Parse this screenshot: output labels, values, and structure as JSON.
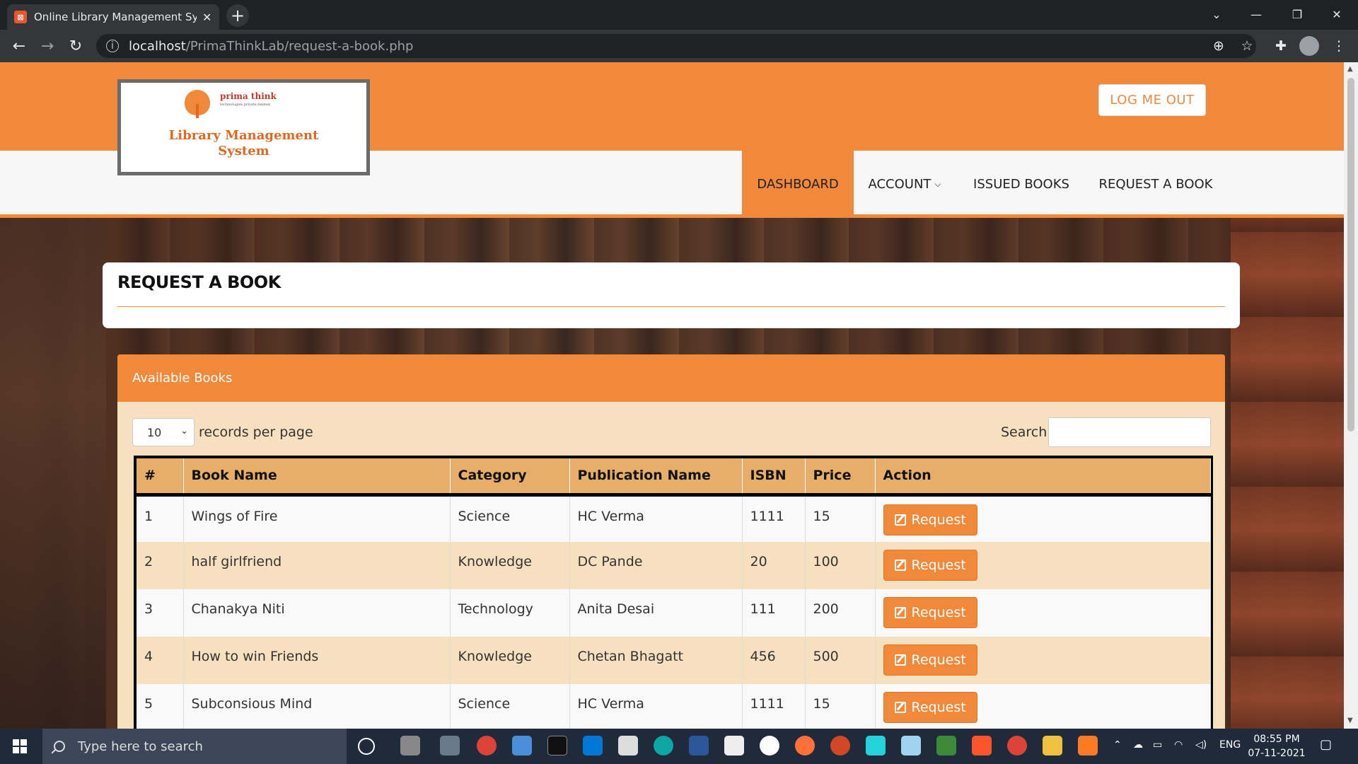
{
  "browser": {
    "tab_title": "Online Library Management System",
    "url_host": "localhost",
    "url_path": "/PrimaThinkLab/request-a-book.php"
  },
  "site": {
    "brand": "prima think",
    "brand_sub": "technologies private limited",
    "system_title": "Library Management System",
    "logout_label": "LOG ME OUT",
    "menu": [
      {
        "label": "DASHBOARD",
        "active": true
      },
      {
        "label": "ACCOUNT",
        "active": false
      },
      {
        "label": "ISSUED BOOKS",
        "active": false
      },
      {
        "label": "REQUEST A BOOK",
        "active": false
      }
    ]
  },
  "page": {
    "title": "REQUEST A BOOK",
    "panel_title": "Available Books",
    "records_per_page_value": "10",
    "records_per_page_label": "records per page",
    "search_label": "Search:",
    "columns": [
      "#",
      "Book Name",
      "Category",
      "Publication Name",
      "ISBN",
      "Price",
      "Action"
    ],
    "rows": [
      {
        "num": "1",
        "name": "Wings of Fire",
        "category": "Science",
        "publication": "HC Verma",
        "isbn": "1111",
        "price": "15"
      },
      {
        "num": "2",
        "name": "half girlfriend",
        "category": "Knowledge",
        "publication": "DC Pande",
        "isbn": "20",
        "price": "100"
      },
      {
        "num": "3",
        "name": "Chanakya Niti",
        "category": "Technology",
        "publication": "Anita Desai",
        "isbn": "111",
        "price": "200"
      },
      {
        "num": "4",
        "name": "How to win Friends",
        "category": "Knowledge",
        "publication": "Chetan Bhagatt",
        "isbn": "456",
        "price": "500"
      },
      {
        "num": "5",
        "name": "Subconsious Mind",
        "category": "Science",
        "publication": "HC Verma",
        "isbn": "1111",
        "price": "15"
      }
    ],
    "request_label": "Request"
  },
  "taskbar": {
    "search_placeholder": "Type here to search",
    "lang": "ENG",
    "time": "08:55 PM",
    "date": "07-11-2021"
  },
  "colors": {
    "accent": "#f0893a",
    "table_header": "#e6ae69",
    "row_alt": "#f7e0c0"
  }
}
